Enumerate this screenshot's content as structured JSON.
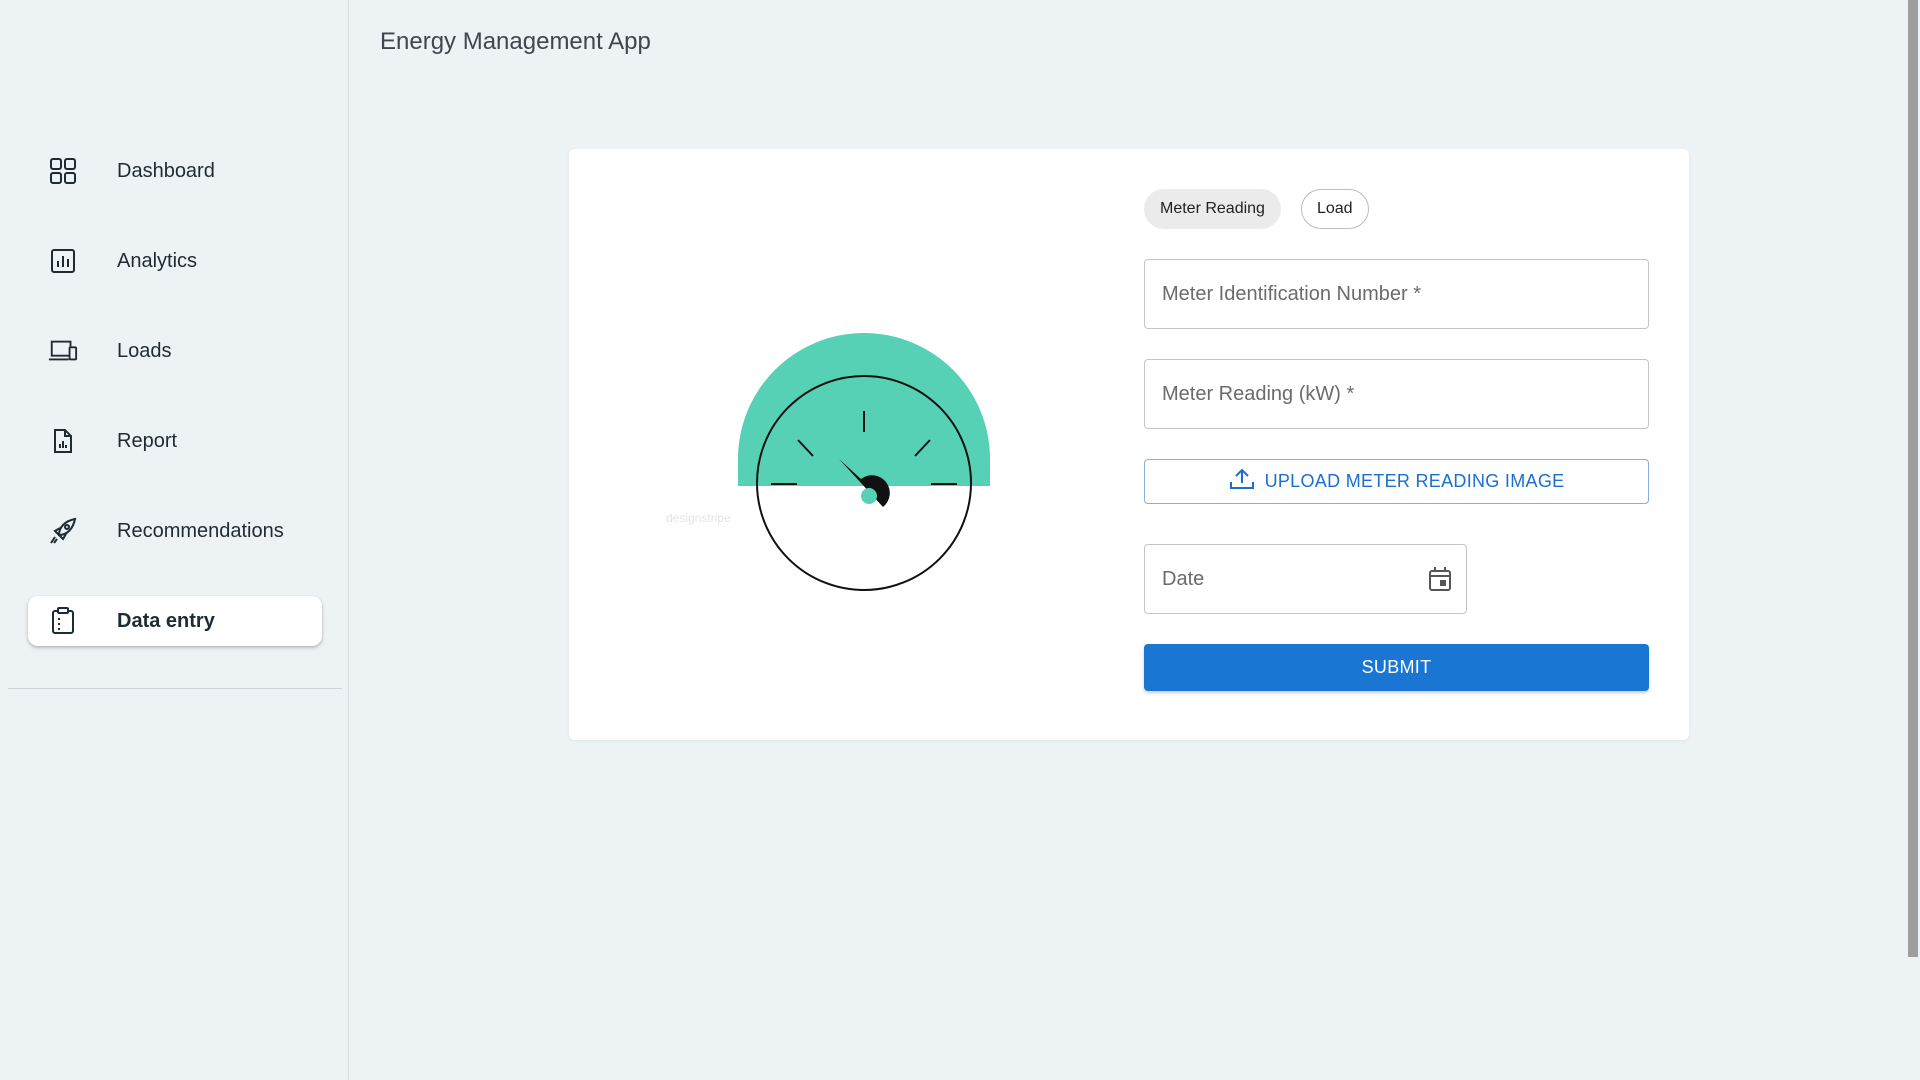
{
  "app": {
    "title": "Energy Management App"
  },
  "sidebar": {
    "items": [
      {
        "label": "Dashboard",
        "icon": "dashboard-icon",
        "active": false
      },
      {
        "label": "Analytics",
        "icon": "analytics-icon",
        "active": false
      },
      {
        "label": "Loads",
        "icon": "devices-icon",
        "active": false
      },
      {
        "label": "Report",
        "icon": "report-icon",
        "active": false
      },
      {
        "label": "Recommendations",
        "icon": "rocket-icon",
        "active": false
      },
      {
        "label": "Data entry",
        "icon": "clipboard-icon",
        "active": true
      }
    ]
  },
  "form": {
    "chips": [
      {
        "label": "Meter Reading",
        "selected": true
      },
      {
        "label": "Load",
        "selected": false
      }
    ],
    "meter_id_placeholder": "Meter Identification Number *",
    "meter_reading_placeholder": "Meter Reading (kW) *",
    "upload_label": "UPLOAD METER READING IMAGE",
    "date_placeholder": "Date",
    "submit_label": "SUBMIT"
  },
  "illustration": {
    "icon": "gauge-illustration",
    "watermark": "designstripe",
    "accent": "#57d1b5"
  },
  "colors": {
    "primary": "#1976d2",
    "background": "#edf2f4",
    "card": "#ffffff"
  }
}
